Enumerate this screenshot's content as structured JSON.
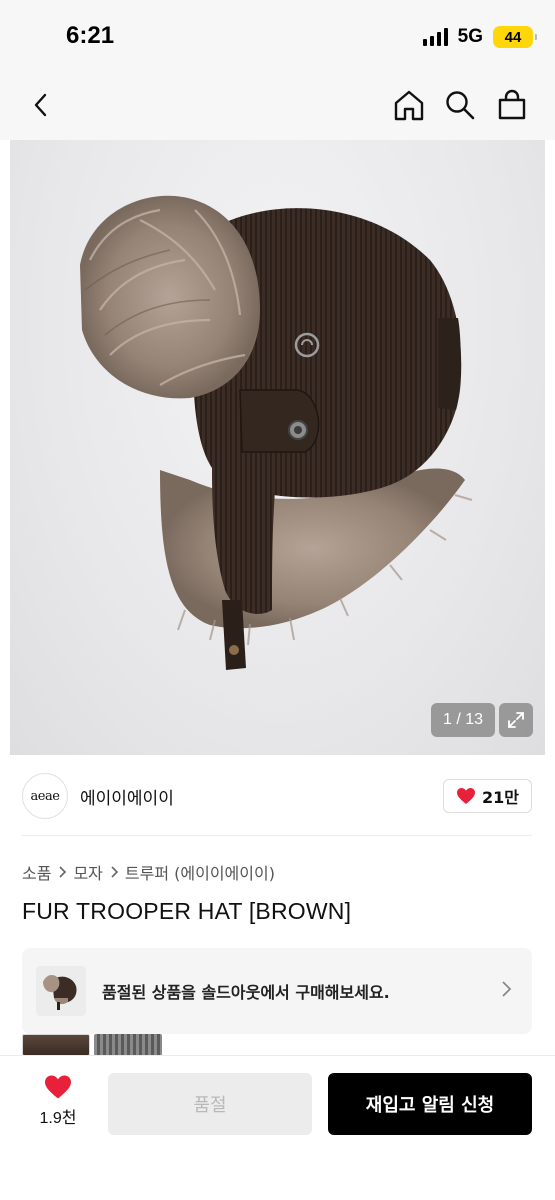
{
  "status_bar": {
    "time": "6:21",
    "network": "5G",
    "battery": "44",
    "battery_color": "#ffd60a"
  },
  "nav": {
    "back_icon": "chevron-left-icon",
    "home_icon": "home-icon",
    "search_icon": "search-icon",
    "bag_icon": "shopping-bag-icon"
  },
  "gallery": {
    "counter": "1 / 13",
    "expand_icon": "expand-icon"
  },
  "brand": {
    "logo_text": "aeae",
    "name": "에이이에이이",
    "likes": "21만",
    "like_color": "#e8203a"
  },
  "breadcrumb": {
    "items": [
      "소품",
      "모자",
      "트루퍼 (에이이에이이)"
    ]
  },
  "product": {
    "title": "FUR TROOPER HAT [BROWN]"
  },
  "soldout_banner": {
    "text": "품절된 상품을 솔드아웃에서 구매해보세요."
  },
  "bottom_bar": {
    "wish_count": "1.9천",
    "soldout_label": "품절",
    "restock_label": "재입고 알림 신청"
  }
}
